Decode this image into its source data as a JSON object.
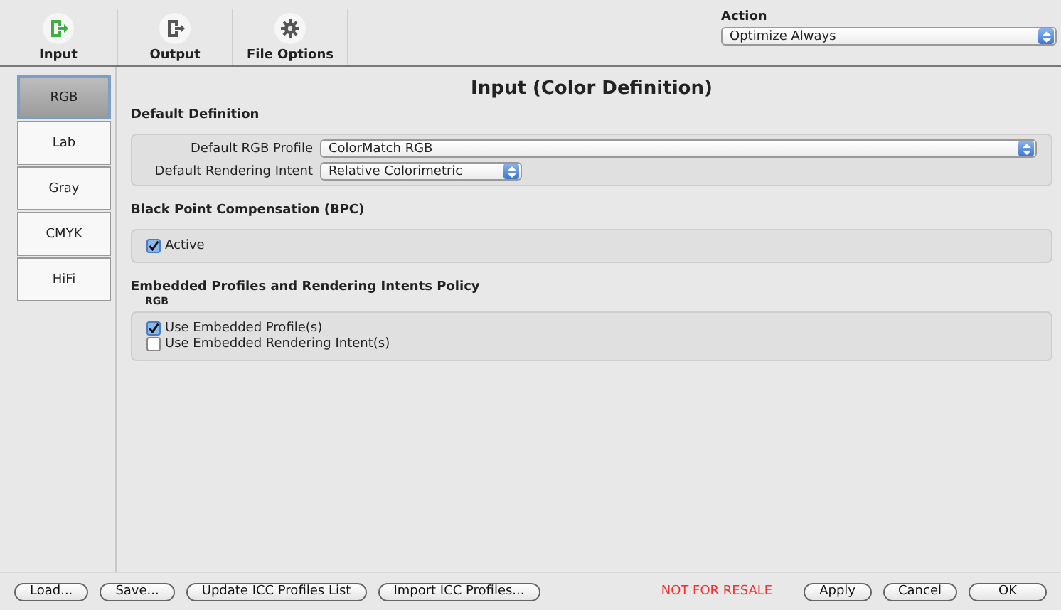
{
  "toolbar": [
    {
      "label": "Input",
      "kind": "input",
      "selected": true
    },
    {
      "label": "Output",
      "kind": "output",
      "selected": false
    },
    {
      "label": "File Options",
      "kind": "options",
      "selected": false
    }
  ],
  "action": {
    "label": "Action",
    "value": "Optimize Always"
  },
  "sidebar": [
    {
      "label": "RGB",
      "selected": true
    },
    {
      "label": "Lab",
      "selected": false
    },
    {
      "label": "Gray",
      "selected": false
    },
    {
      "label": "CMYK",
      "selected": false
    },
    {
      "label": "HiFi",
      "selected": false
    }
  ],
  "title": "Input (Color Definition)",
  "default_definition": {
    "heading": "Default Definition",
    "fields": [
      {
        "label": "Default RGB Profile",
        "value": "ColorMatch RGB"
      },
      {
        "label": "Default Rendering Intent",
        "value": "Relative Colorimetric"
      }
    ]
  },
  "bpc": {
    "heading": "Black Point Compensation (BPC)",
    "checkboxes": [
      {
        "label": "Active",
        "checked": true
      }
    ]
  },
  "embedded": {
    "heading": "Embedded Profiles and Rendering Intents Policy",
    "sublabel": "RGB",
    "checkboxes": [
      {
        "label": "Use Embedded Profile(s)",
        "checked": true
      },
      {
        "label": "Use Embedded Rendering Intent(s)",
        "checked": false
      }
    ]
  },
  "footer": {
    "left_buttons": [
      "Load...",
      "Save...",
      "Update ICC Profiles List",
      "Import ICC Profiles..."
    ],
    "notice": "NOT FOR RESALE",
    "right_buttons": [
      "Apply",
      "Cancel",
      "OK"
    ]
  }
}
